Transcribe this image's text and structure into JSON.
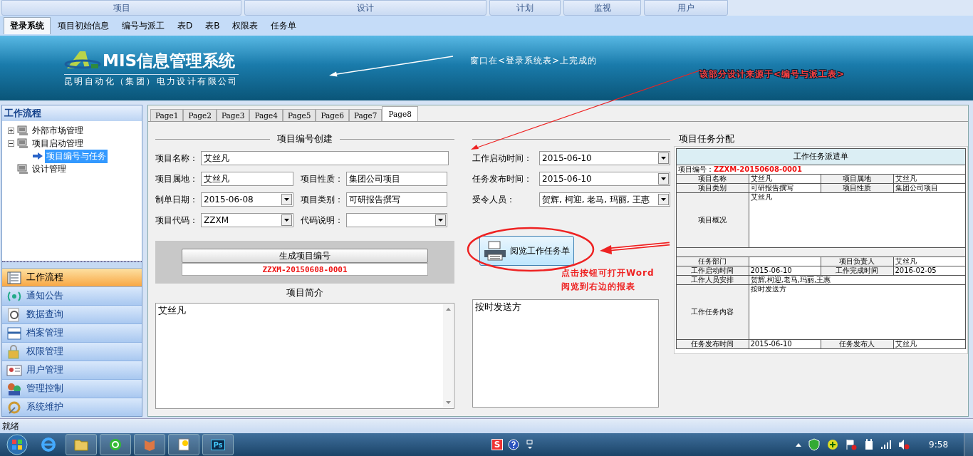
{
  "ribbon_groups": [
    {
      "label": "项目"
    },
    {
      "label": "设计"
    },
    {
      "label": "计划"
    },
    {
      "label": "监视"
    },
    {
      "label": "用户"
    }
  ],
  "form_tabs": [
    {
      "label": "登录系统",
      "selected": true
    },
    {
      "label": "项目初始信息",
      "selected": false
    },
    {
      "label": "编号与派工",
      "selected": false
    },
    {
      "label": "表D",
      "selected": false
    },
    {
      "label": "表B",
      "selected": false
    },
    {
      "label": "权限表",
      "selected": false
    },
    {
      "label": "任务单",
      "selected": false
    }
  ],
  "banner": {
    "logo_title": "MIS信息管理系统",
    "logo_subtitle": "昆明自动化（集团）电力设计有限公司",
    "note": "窗口在<登录系统表>上完成的",
    "red_note": "该部分设计来源于<编号与派工表>"
  },
  "sidebar": {
    "title": "工作流程",
    "tree": [
      {
        "label": "外部市场管理",
        "kind": "group",
        "expanded": false,
        "selected": false
      },
      {
        "label": "项目启动管理",
        "kind": "group",
        "expanded": true,
        "selected": false,
        "children": [
          {
            "label": "项目编号与任务",
            "kind": "item",
            "selected": true
          }
        ]
      },
      {
        "label": "设计管理",
        "kind": "group",
        "selected": false
      }
    ],
    "nav": [
      {
        "label": "工作流程",
        "selected": true
      },
      {
        "label": "通知公告",
        "selected": false
      },
      {
        "label": "数据查询",
        "selected": false
      },
      {
        "label": "档案管理",
        "selected": false
      },
      {
        "label": "权限管理",
        "selected": false
      },
      {
        "label": "用户管理",
        "selected": false
      },
      {
        "label": "管理控制",
        "selected": false
      },
      {
        "label": "系统维护",
        "selected": false
      }
    ]
  },
  "page_tabs": [
    {
      "label": "Page1",
      "selected": false
    },
    {
      "label": "Page2",
      "selected": false
    },
    {
      "label": "Page3",
      "selected": false
    },
    {
      "label": "Page4",
      "selected": false
    },
    {
      "label": "Page5",
      "selected": false
    },
    {
      "label": "Page6",
      "selected": false
    },
    {
      "label": "Page7",
      "selected": false
    },
    {
      "label": "Page8",
      "selected": true
    }
  ],
  "creation": {
    "title": "项目编号创建",
    "rows": [
      [
        {
          "label": "项目名称：",
          "value": "艾丝凡",
          "kind": "text"
        }
      ],
      [
        {
          "label": "项目属地：",
          "value": "艾丝凡",
          "kind": "text"
        },
        {
          "label": "项目性质：",
          "value": "集团公司项目",
          "kind": "text"
        }
      ],
      [
        {
          "label": "制单日期：",
          "value": "2015-06-08",
          "kind": "dropdown"
        },
        {
          "label": "项目类别：",
          "value": "可研报告撰写",
          "kind": "text"
        }
      ],
      [
        {
          "label": "项目代码：",
          "value": "ZZXM",
          "kind": "dropdown"
        },
        {
          "label": "代码说明：",
          "kind": "dropdown"
        }
      ]
    ],
    "generate_button": "生成项目编号",
    "generated_number": "ZZXM-20150608-0001",
    "intro_label": "项目简介",
    "intro_text": "艾丝凡"
  },
  "assignment": {
    "title": "项目任务分配",
    "fields": [
      {
        "label": "工作启动时间：",
        "value": "2015-06-10",
        "kind": "dropdown"
      },
      {
        "label": "任务发布时间：",
        "value": "2015-06-10",
        "kind": "dropdown"
      },
      {
        "label": "受令人员：",
        "value": "贺辉, 柯迎, 老马, 玛丽, 王惠",
        "kind": "dropdown"
      }
    ],
    "view_button": "阅览工作任务单",
    "note_lines": [
      "点击按钮可打开Word",
      "阅览到右边的报表"
    ],
    "content_text": "按时发送方"
  },
  "document": {
    "title": "工作任务派遣单",
    "number_label": "项目编号：",
    "number": "ZZXM-20150608-0001",
    "rows": [
      {
        "kind": "pair",
        "cells": [
          "项目名称",
          "艾丝凡",
          "项目属地",
          "艾丝凡"
        ]
      },
      {
        "kind": "pair",
        "cells": [
          "项目类别",
          "可研报告撰写",
          "项目性质",
          "集团公司项目"
        ]
      },
      {
        "kind": "tall",
        "cells": [
          "项目概况",
          "艾丝凡"
        ]
      },
      {
        "kind": "blank"
      },
      {
        "kind": "pair",
        "cells": [
          "任务部门",
          null,
          "项目负责人",
          "艾丝凡"
        ]
      },
      {
        "kind": "pair",
        "cells": [
          "工作启动时间",
          "2015-06-10",
          "工作完成时间",
          "2016-02-05"
        ]
      },
      {
        "kind": "wide",
        "cells": [
          "工作人员安排",
          "贺辉,柯迎,老马,玛丽,王惠"
        ]
      },
      {
        "kind": "tall",
        "cells": [
          "工作任务内容",
          "按时发送方"
        ]
      },
      {
        "kind": "pair",
        "cells": [
          "任务发布时间",
          "2015-06-10",
          "任务发布人",
          "艾丝凡"
        ]
      }
    ]
  },
  "status_bar": "就绪",
  "taskbar": {
    "photoshop_label": "Ps",
    "tray_badge": "S",
    "clock": "9:58"
  }
}
